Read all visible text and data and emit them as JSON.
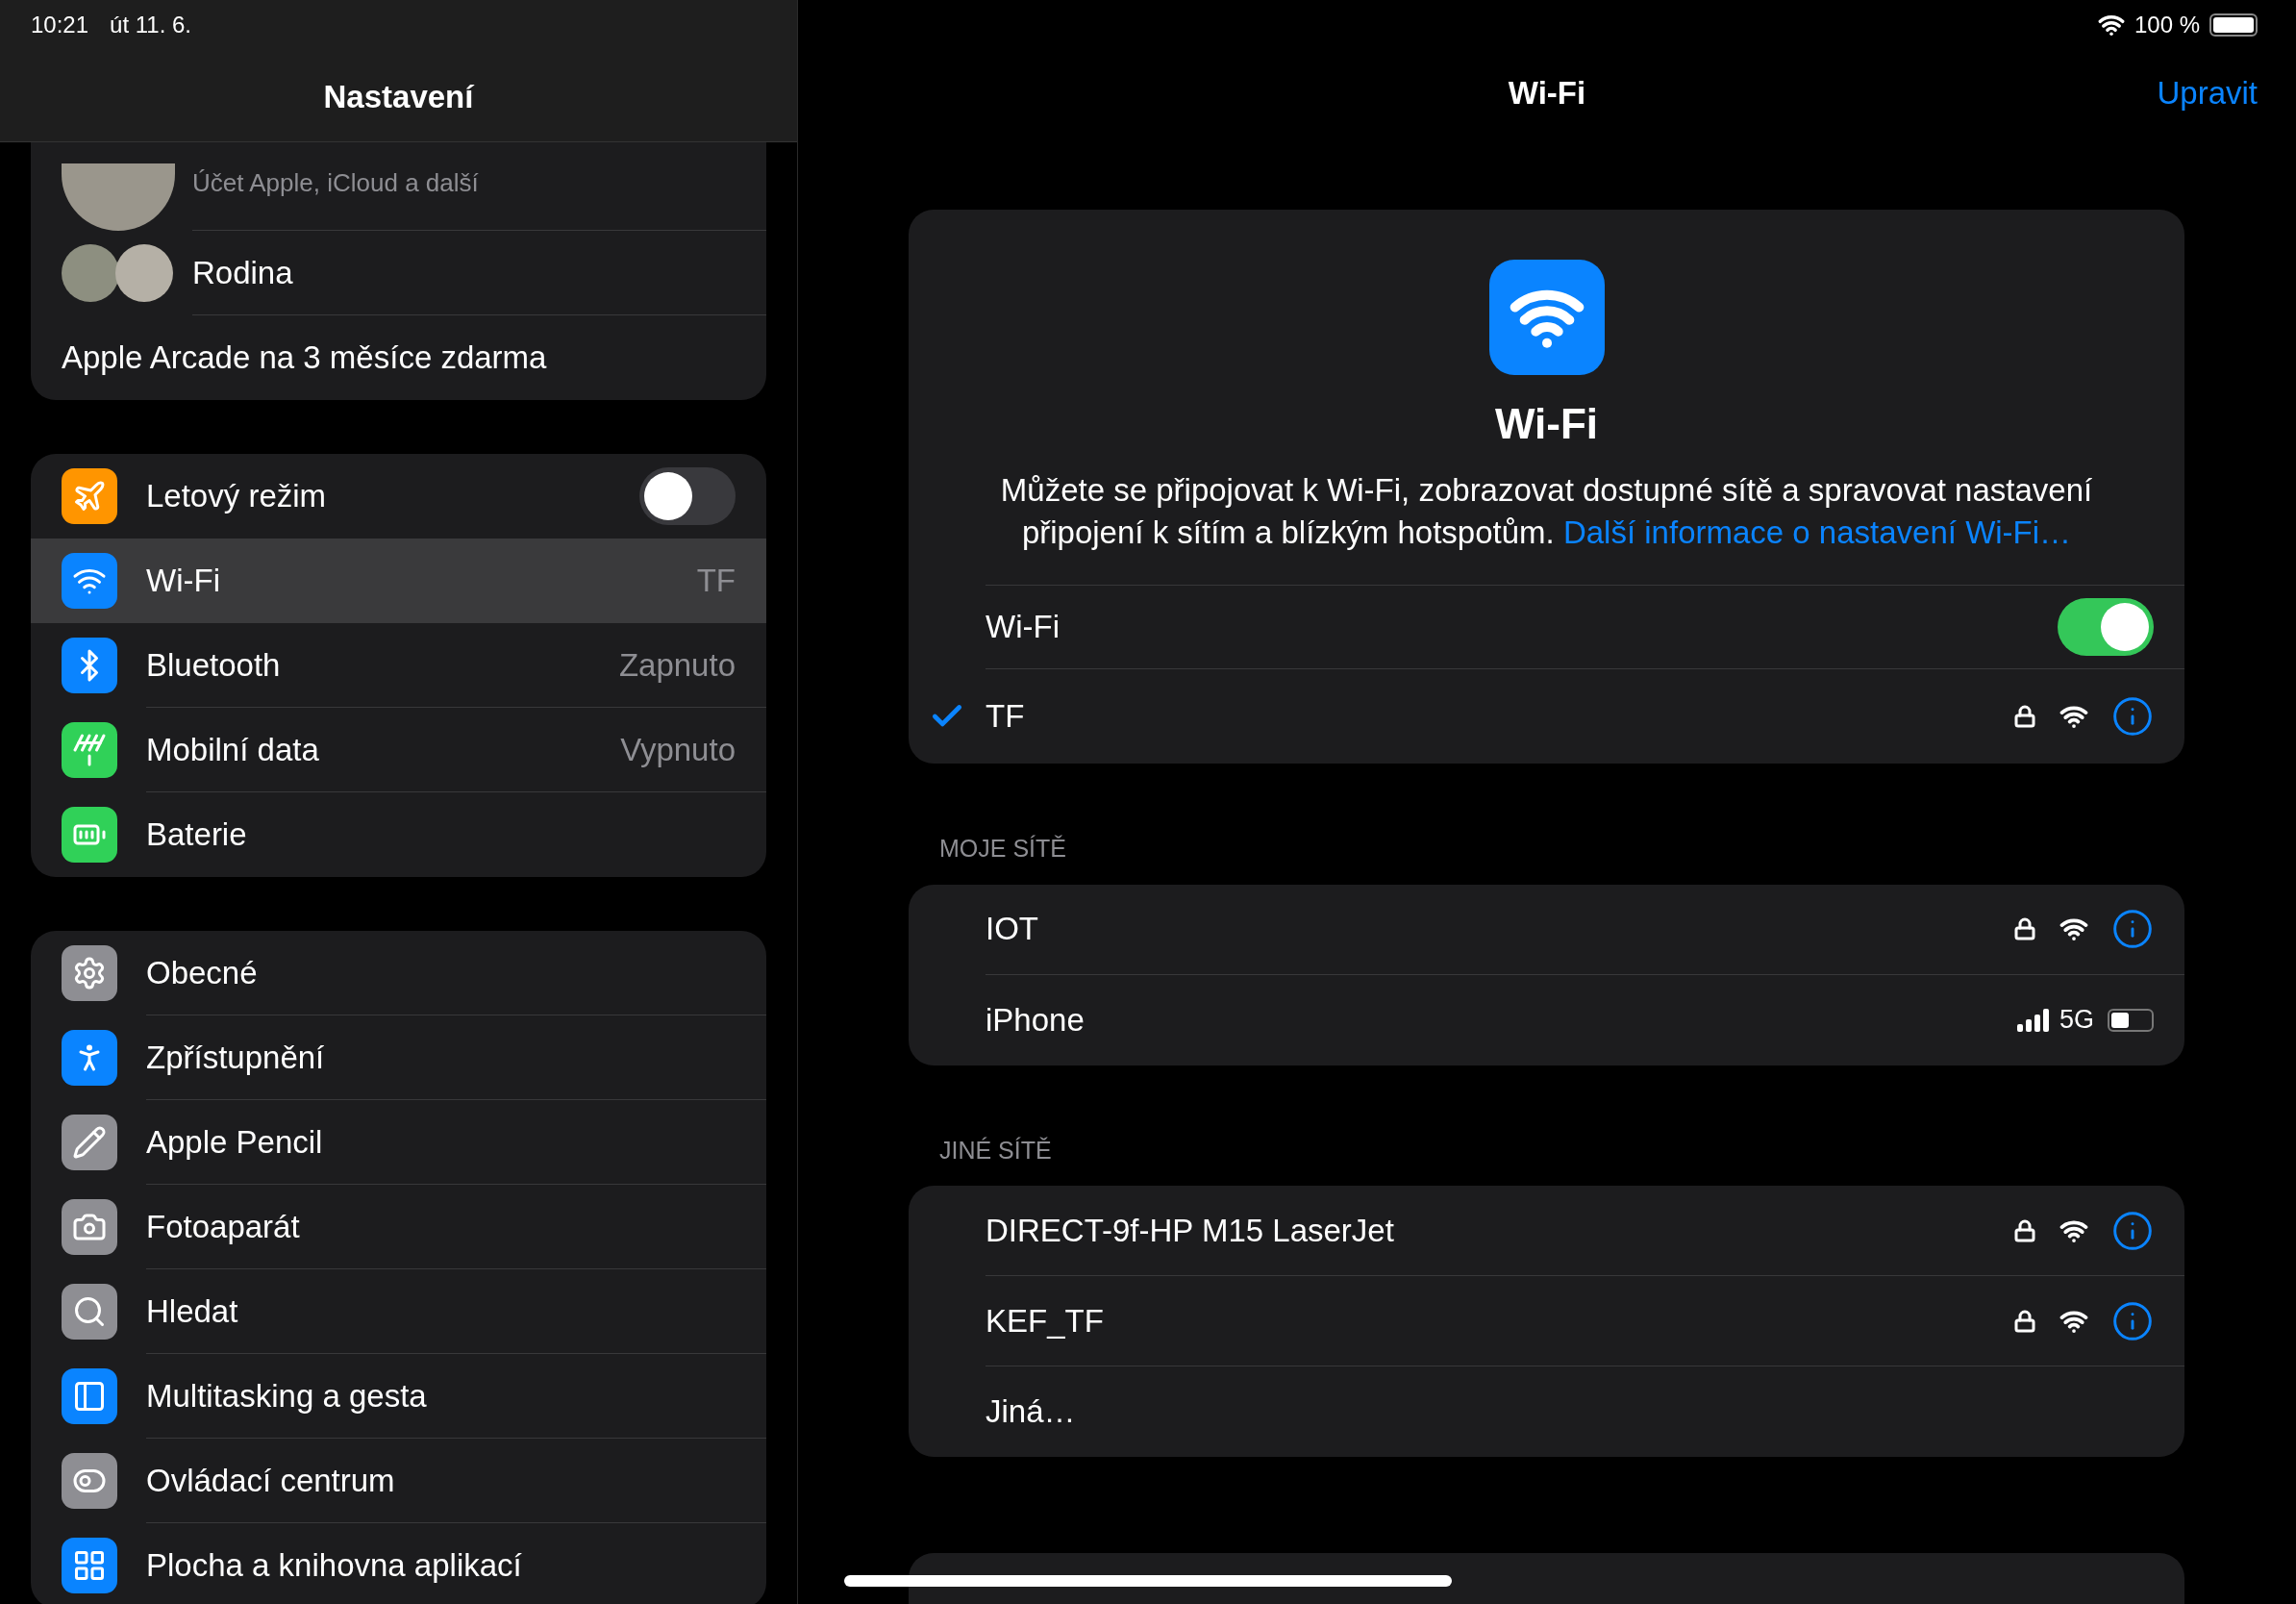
{
  "status_bar": {
    "time": "10:21",
    "date": "út 11. 6.",
    "battery": "100 %"
  },
  "sidebar": {
    "title": "Nastavení",
    "account": {
      "subtitle": "Účet Apple, iCloud a další"
    },
    "family": {
      "label": "Rodina"
    },
    "promo": "Apple Arcade na 3 měsíce zdarma",
    "groups": [
      [
        {
          "kind": "toggle",
          "label": "Letový režim",
          "on": false,
          "selected": false,
          "color": "#ff9500"
        },
        {
          "kind": "value",
          "label": "Wi-Fi",
          "value": "TF",
          "selected": true,
          "color": "#0a84ff"
        },
        {
          "kind": "value",
          "label": "Bluetooth",
          "value": "Zapnuto",
          "selected": false,
          "color": "#0a84ff"
        },
        {
          "kind": "value",
          "label": "Mobilní data",
          "value": "Vypnuto",
          "selected": false,
          "color": "#30d158"
        },
        {
          "kind": "plain",
          "label": "Baterie",
          "selected": false,
          "color": "#30d158"
        }
      ],
      [
        {
          "kind": "plain",
          "label": "Obecné",
          "selected": false,
          "color": "#8e8e93"
        },
        {
          "kind": "plain",
          "label": "Zpřístupnění",
          "selected": false,
          "color": "#0a84ff"
        },
        {
          "kind": "plain",
          "label": "Apple Pencil",
          "selected": false,
          "color": "#8e8e93"
        },
        {
          "kind": "plain",
          "label": "Fotoaparát",
          "selected": false,
          "color": "#8e8e93"
        },
        {
          "kind": "plain",
          "label": "Hledat",
          "selected": false,
          "color": "#8e8e93"
        },
        {
          "kind": "plain",
          "label": "Multitasking a gesta",
          "selected": false,
          "color": "#0a84ff"
        },
        {
          "kind": "plain",
          "label": "Ovládací centrum",
          "selected": false,
          "color": "#8e8e93"
        },
        {
          "kind": "plain",
          "label": "Plocha a knihovna aplikací",
          "selected": false,
          "color": "#0a84ff"
        }
      ]
    ]
  },
  "detail": {
    "title": "Wi-Fi",
    "edit_button": "Upravit",
    "header": {
      "title": "Wi-Fi",
      "description": "Můžete se připojovat k Wi-Fi, zobrazovat dostupné sítě a spravovat nastavení připojení k sítím a blízkým hotspotům.",
      "link": "Další informace o nastavení Wi-Fi…"
    },
    "wifi_toggle": {
      "label": "Wi-Fi",
      "on": true
    },
    "current": {
      "name": "TF",
      "connected": true,
      "secured": true
    },
    "sections": [
      {
        "title": "MOJE SÍTĚ",
        "networks": [
          {
            "kind": "wifi",
            "name": "IOT",
            "secured": true
          },
          {
            "kind": "hotspot",
            "name": "iPhone",
            "network_type": "5G",
            "level": 0.45
          }
        ]
      },
      {
        "title": "JINÉ SÍTĚ",
        "networks": [
          {
            "kind": "wifi",
            "name": "DIRECT-9f-HP M15 LaserJet",
            "secured": true
          },
          {
            "kind": "wifi",
            "name": "KEF_TF",
            "secured": true
          },
          {
            "kind": "other",
            "name": "Jiná…"
          }
        ]
      }
    ]
  }
}
